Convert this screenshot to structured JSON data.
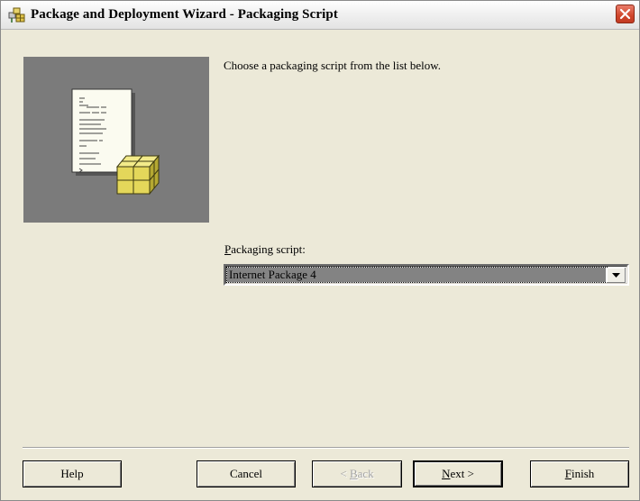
{
  "window": {
    "title": "Package and Deployment Wizard - Packaging Script",
    "title_icon": "package-wizard-icon",
    "close_icon": "close-icon"
  },
  "main": {
    "illustration_icon": "script-document-package-icon",
    "instruction": "Choose a packaging script from the list below.",
    "field": {
      "label_prefix": "",
      "label_accel": "P",
      "label_rest": "ackaging script:",
      "selected_value": "Internet Package 4",
      "dropdown_icon": "chevron-down-icon"
    }
  },
  "buttons": {
    "help": "Help",
    "cancel": "Cancel",
    "back_prefix": "< ",
    "back_accel": "B",
    "back_rest": "ack",
    "next_accel": "N",
    "next_rest": "ext >",
    "finish_accel": "F",
    "finish_rest": "inish"
  },
  "colors": {
    "window_bg": "#ece9d8",
    "illustration_bg": "#7b7b7b",
    "close_red": "#d0462b",
    "selection_bg": "#7a7a7a"
  }
}
